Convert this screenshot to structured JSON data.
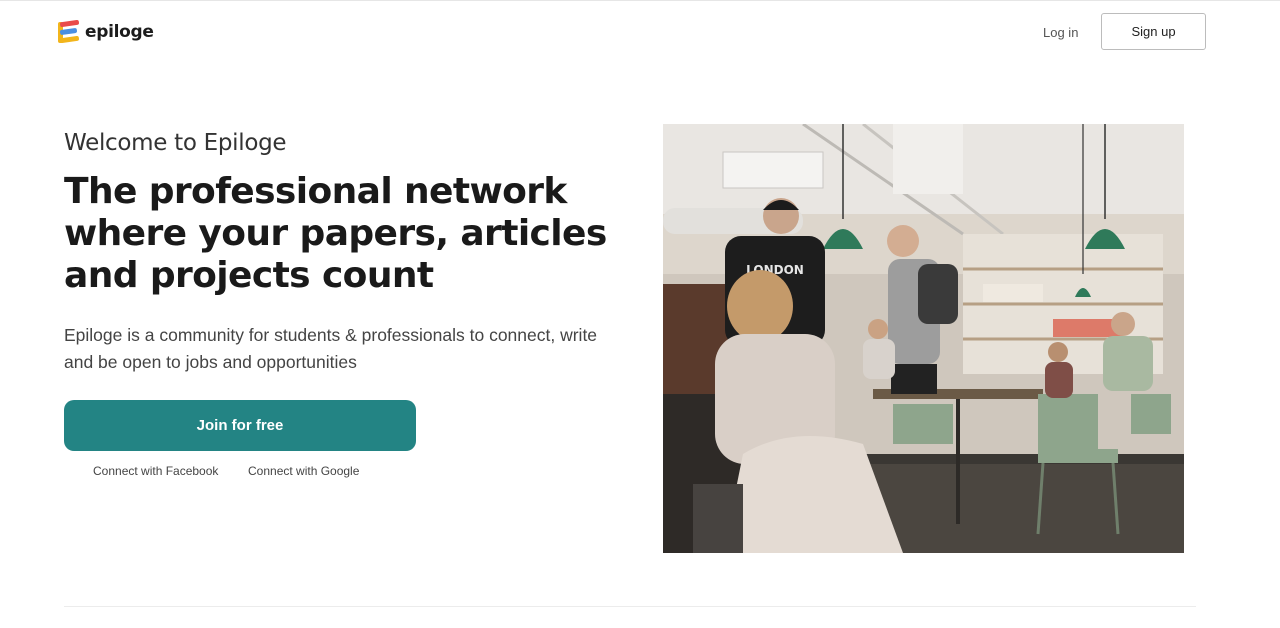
{
  "brand": {
    "name": "epiloge",
    "logo_icon": "epiloge-logo-icon"
  },
  "nav": {
    "login_label": "Log in",
    "signup_label": "Sign up"
  },
  "hero": {
    "welcome": "Welcome to Epiloge",
    "headline": "The professional network where your papers, articles and projects count",
    "subtext": "Epiloge is a community for students & professionals to connect, write and be open to jobs and opportunities",
    "join_label": "Join for free",
    "connect_facebook": "Connect with Facebook",
    "connect_google": "Connect with Google",
    "image_shirt_text": "LONDON"
  },
  "colors": {
    "accent": "#238484",
    "text": "#1a1a1a"
  }
}
